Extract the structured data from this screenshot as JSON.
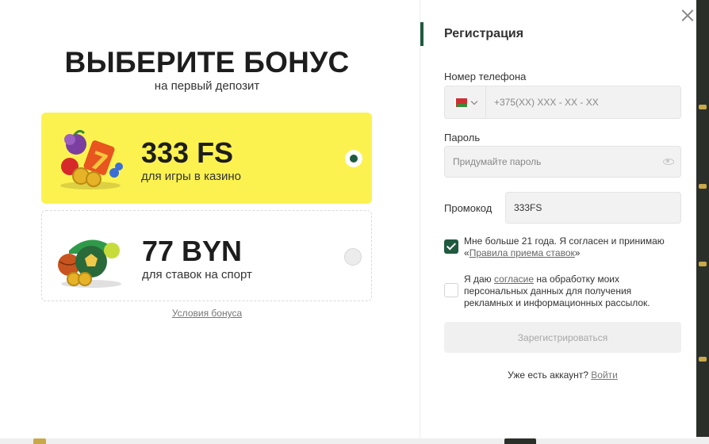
{
  "left": {
    "title": "ВЫБЕРИТЕ БОНУС",
    "subtitle": "на первый депозит",
    "cards": [
      {
        "amount": "333 FS",
        "desc": "для игры в казино",
        "selected": true,
        "icon": "slot-fruits-image"
      },
      {
        "amount": "77 BYN",
        "desc": "для ставок на спорт",
        "selected": false,
        "icon": "sport-balls-image"
      }
    ],
    "terms_link": "Условия бонуса"
  },
  "right": {
    "title": "Регистрация",
    "phone": {
      "label": "Номер телефона",
      "placeholder": "+375(XX) XXX - XX - XX",
      "country_flag": "belarus-flag-icon"
    },
    "password": {
      "label": "Пароль",
      "placeholder": "Придумайте пароль"
    },
    "promo": {
      "label": "Промокод",
      "value": "333FS"
    },
    "consent_age": {
      "checked": true,
      "text_before": "Мне больше 21 года. Я согласен и принимаю «",
      "link": "Правила приема ставок",
      "text_after": "»"
    },
    "consent_data": {
      "checked": false,
      "text_before": "Я даю ",
      "link": "согласие",
      "text_after": " на обработку моих персональных данных для получения рекламных и информационных рассылок."
    },
    "submit_label": "Зарегистрироваться",
    "login_prompt": "Уже есть аккаунт?",
    "login_link": "Войти"
  },
  "colors": {
    "accent_green": "#1f5a3f",
    "card_yellow": "#fbf250"
  }
}
